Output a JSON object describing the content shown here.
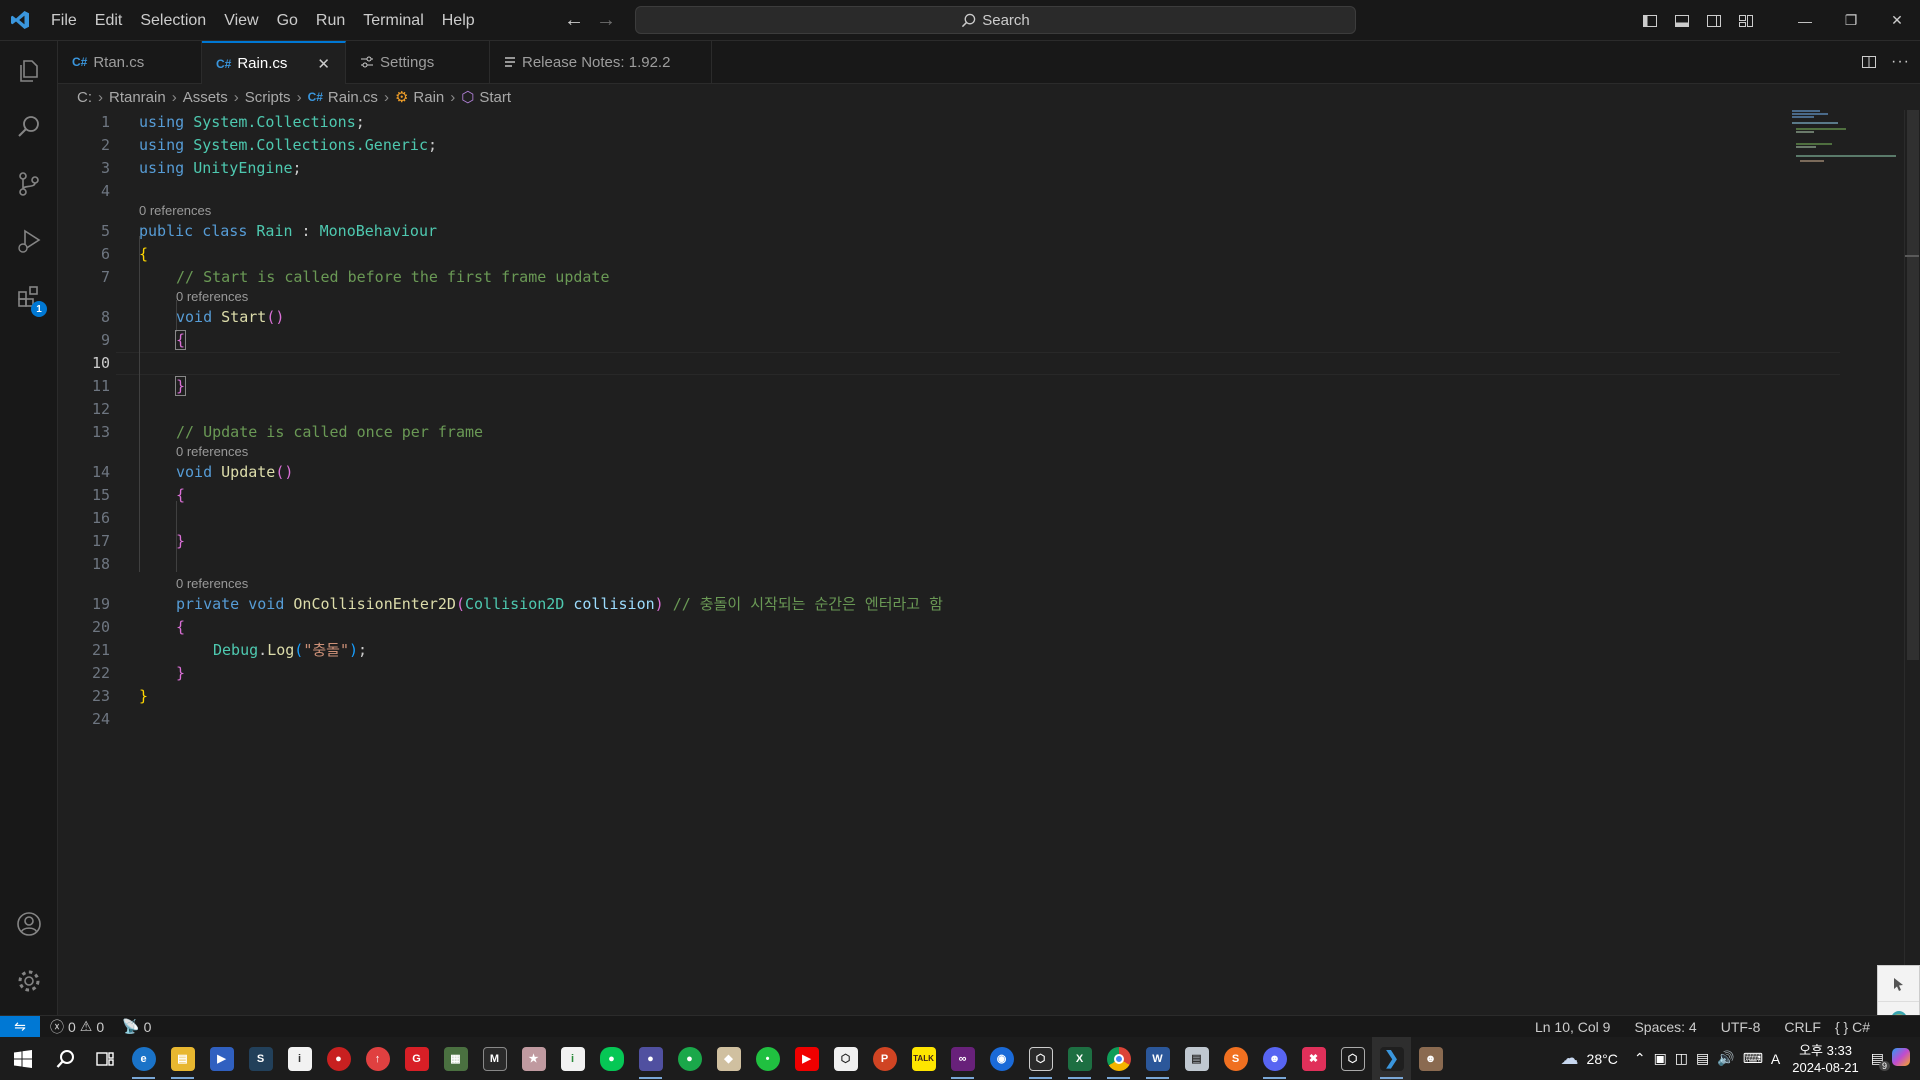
{
  "menu": [
    "File",
    "Edit",
    "Selection",
    "View",
    "Go",
    "Run",
    "Terminal",
    "Help"
  ],
  "search": {
    "label": "Search"
  },
  "tabs": [
    {
      "label": "Rtan.cs",
      "icon": "C#"
    },
    {
      "label": "Rain.cs",
      "icon": "C#",
      "active": true
    },
    {
      "label": "Settings",
      "icon": "settings-icon"
    },
    {
      "label": "Release Notes: 1.92.2",
      "icon": "notes-icon"
    }
  ],
  "breadcrumb": [
    "C:",
    "Rtanrain",
    "Assets",
    "Scripts",
    "Rain.cs",
    "Rain",
    "Start"
  ],
  "activity": {
    "extensions_badge": "1"
  },
  "codelens": {
    "refs": "0 references"
  },
  "code": {
    "l1_kw": "using",
    "l1_ns": "System.Collections",
    "semi": ";",
    "l2_kw": "using",
    "l2_ns": "System.Collections.Generic",
    "l3_kw": "using",
    "l3_ns": "UnityEngine",
    "l5_public": "public",
    "l5_class": "class",
    "l5_name": "Rain",
    "l5_colon": " : ",
    "l5_base": "MonoBehaviour",
    "open_brace": "{",
    "close_brace": "}",
    "l7_comment": "// Start is called before the first frame update",
    "void": "void",
    "start": "Start",
    "parens": "()",
    "l13_comment": "// Update is called once per frame",
    "update": "Update",
    "private": "private",
    "collision_fn": "OnCollisionEnter2D",
    "lparen": "(",
    "rparen": ")",
    "collision_type": "Collision2D",
    "collision_param": "collision",
    "l19_comment": "// 충돌이 시작되는 순간은 엔터라고 함",
    "debug": "Debug",
    "dot": ".",
    "log": "Log",
    "log_str": "\"충돌\"",
    "log_end": ";"
  },
  "line_numbers": [
    "1",
    "2",
    "3",
    "4",
    "5",
    "6",
    "7",
    "8",
    "9",
    "10",
    "11",
    "12",
    "13",
    "14",
    "15",
    "16",
    "17",
    "18",
    "19",
    "20",
    "21",
    "22",
    "23",
    "24"
  ],
  "status": {
    "errors": "0",
    "warnings": "0",
    "ports": "0",
    "position": "Ln 10, Col 9",
    "spaces": "Spaces: 4",
    "encoding": "UTF-8",
    "eol": "CRLF",
    "language": "C#",
    "lang_braces": "{ }"
  },
  "taskbar": {
    "weather": "28°C",
    "ime": "A",
    "time": "오후 3:33",
    "date": "2024-08-21",
    "notifications": "9"
  },
  "colors": {
    "accent": "#0078d4",
    "keyword": "#569cd6",
    "type": "#4ec9b0",
    "function": "#dcdcaa",
    "comment": "#6a9955",
    "string": "#ce9178"
  }
}
